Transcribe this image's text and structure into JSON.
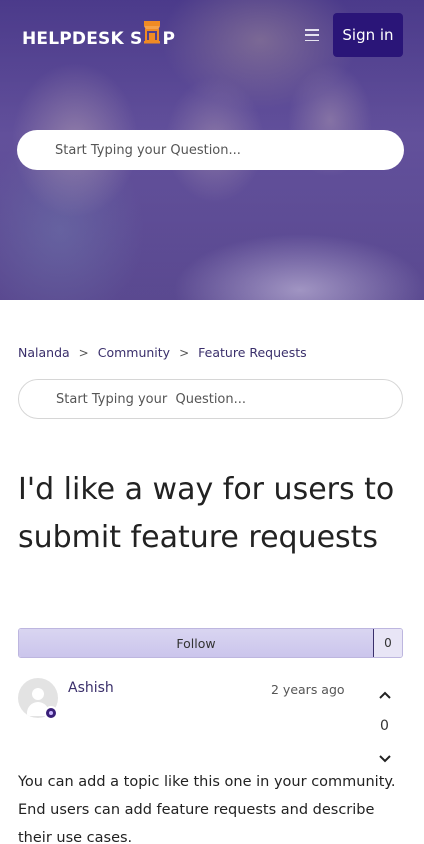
{
  "header": {
    "logo_part1": "HELPDESK S",
    "logo_part2": "P",
    "signin_label": "Sign in",
    "menu_icon": "hamburger-icon",
    "brand_color": "#2a1578",
    "logo_accent": "#f08a24"
  },
  "hero": {
    "search_placeholder": "Start Typing your Question..."
  },
  "breadcrumb": {
    "items": [
      "Nalanda",
      "Community",
      "Feature Requests"
    ],
    "separator": ">"
  },
  "search": {
    "placeholder": "Start Typing your  Question..."
  },
  "topic": {
    "title": "I'd like a way for users to submit feature requests",
    "follow_label": "Follow",
    "follow_count": "0"
  },
  "post": {
    "author": "Ashish",
    "time": "2 years ago",
    "vote_count": "0",
    "body": "You can add a topic like this one in your community. End users can add feature requests and describe their use cases."
  }
}
